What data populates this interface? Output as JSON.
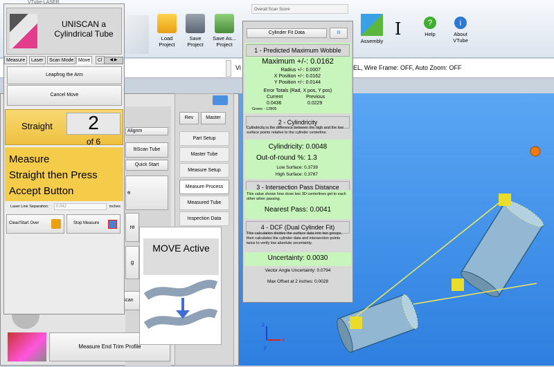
{
  "app": {
    "title_fragment": "VTube-LASER",
    "status_text_left": "Vi",
    "status_text_right": "EL, Wire Frame: OFF, Auto Zoom: OFF",
    "green_label": "Green - 12805"
  },
  "toolbar": {
    "load": "Load\nProject",
    "save": "Save\nProject",
    "save_as": "Save As...\nProject",
    "assembly": "Assembly",
    "help": "Help",
    "about": "About\nVTube"
  },
  "left_panel": {
    "title_line1": "UNISCAN a",
    "title_line2": "Cylindrical Tube",
    "tabs": [
      "Measure",
      "Laser",
      "Scan Mode",
      "Move",
      "Cl"
    ],
    "active_tab": "Move",
    "leapfrog": "Leapfrog the Arm",
    "cancel_move": "Cancel Move",
    "straight_label": "Straight",
    "straight_num": "2",
    "of_label": "of 6",
    "instruction": "Measure\nStraight then Press\nAccept Button",
    "laser_sep_label": "Laser Line Separation:",
    "laser_sep_value": "0.042",
    "laser_sep_unit": "inches",
    "clear_btn": "Clear/Start Over",
    "stop_btn": "Stop Measure"
  },
  "background_panel": {
    "alignm": "Alignm",
    "multiscan": "ltiScan Tube",
    "quick_start": "Quick Start",
    "multiscan2": "ltiScan",
    "measure_end_trim": "Measure End Trim Profile",
    "fragments": [
      "e",
      "re",
      "g"
    ]
  },
  "nav": {
    "rev": "Rev",
    "master": "Master",
    "items": [
      "Part Setup",
      "Master Tube",
      "Measure Setup",
      "Measure Process",
      "Measured Tube",
      "Inspection Data"
    ],
    "active": "Measure Process"
  },
  "move_popup": {
    "title": "MOVE Active"
  },
  "score": {
    "window_title": "Overall Scan Score",
    "header_button": "Cylinder Fit Data",
    "s1_title": "1 - Predicted Maximum Wobble",
    "max_line": "Maximum +/-: 0.0162",
    "radius": "Radius +/-: 0.0007",
    "xpos": "X Position +/-: 0.0162",
    "ypos": "Y Position +/-: 0.0144",
    "err_title": "Error Totals (Rad, X pos, Y pos)",
    "err_current_label": "Current",
    "err_previous_label": "Previous",
    "err_current": "0.0436",
    "err_previous": "0.0229",
    "s2_title": "2 - Cylindricity",
    "s2_desc": "Cylindricity is the difference between the high and the low surface points relative to the cylinder centerline.",
    "cylindricity": "Cylindricity: 0.0048",
    "out_of_round": "Out-of-round %: 1.3",
    "low_surface": "Low Surface: 0.3739",
    "high_surface": "High Surface: 0.3787",
    "s3_title": "3 - Intersection Pass Distance",
    "s3_desc": "This value shows how close two 3D centerlines get to each other when passing.",
    "nearest": "Nearest Pass: 0.0041",
    "s4_title": "4 - DCF (Dual Cylinder Fit)",
    "s4_desc": "This calculation divides the surface data into two groups, then calculates the cylinder data and intersection points twice to verify low absolute uncertainty.",
    "uncertainty": "Uncertainty: 0.0030",
    "vector_angle": "Vector Angle Uncertainty: 0.0794",
    "max_offset": "Max Offset at 2 inches: 0.0028"
  },
  "axes": {
    "x": "x",
    "y": "y",
    "z": "z"
  },
  "colors": {
    "accent_green": "#c8f5bb",
    "yellow_panel": "#f4cc49",
    "viewport": "#3f91ee"
  }
}
